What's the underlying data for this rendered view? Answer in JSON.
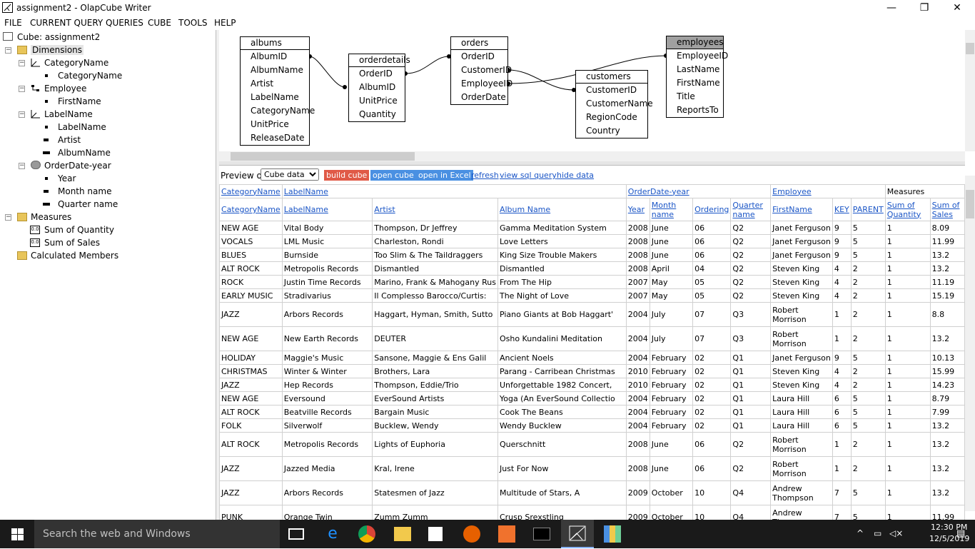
{
  "window": {
    "title": "assignment2 - OlapCube Writer",
    "minimize": "—",
    "restore": "❐",
    "close": "✕"
  },
  "menu": [
    "FILE",
    "CURRENT QUERY",
    "QUERIES",
    "CUBE",
    "TOOLS",
    "HELP"
  ],
  "tree": {
    "root": "Cube: assignment2",
    "dimensions": "Dimensions",
    "category_dim": "CategoryName",
    "category_level": "CategoryName",
    "employee_dim": "Employee",
    "employee_level": "FirstName",
    "label_dim": "LabelName",
    "label_levels": [
      "LabelName",
      "Artist",
      "AlbumName"
    ],
    "orderdate_dim": "OrderDate-year",
    "orderdate_levels": [
      "Year",
      "Month name",
      "Quarter name"
    ],
    "measures": "Measures",
    "measure_items": [
      "Sum of Quantity",
      "Sum of Sales"
    ],
    "calculated": "Calculated Members"
  },
  "diagram": {
    "albums": {
      "name": "albums",
      "fields": [
        "AlbumID",
        "AlbumName",
        "Artist",
        "LabelName",
        "CategoryName",
        "UnitPrice",
        "ReleaseDate"
      ]
    },
    "orderdetails": {
      "name": "orderdetails",
      "fields": [
        "OrderID",
        "AlbumID",
        "UnitPrice",
        "Quantity"
      ]
    },
    "orders": {
      "name": "orders",
      "fields": [
        "OrderID",
        "CustomerID",
        "EmployeeID",
        "OrderDate"
      ]
    },
    "customers": {
      "name": "customers",
      "fields": [
        "CustomerID",
        "CustomerName",
        "RegionCode",
        "Country"
      ]
    },
    "employees": {
      "name": "employees",
      "fields": [
        "EmployeeID",
        "LastName",
        "FirstName",
        "Title",
        "ReportsTo"
      ]
    }
  },
  "preview": {
    "label": "Preview of",
    "select_value": "Cube data",
    "build": "build cube",
    "open_cube": "open cube",
    "open_excel": "open in Excel",
    "links": [
      "refresh",
      "view sql query",
      "hide data"
    ],
    "colors": {
      "build": "#e05a47",
      "open": "#4a90e2"
    }
  },
  "grid": {
    "group_headers": [
      "CategoryName",
      "LabelName",
      "OrderDate-year",
      "Employee",
      "Measures"
    ],
    "columns": [
      "CategoryName",
      "LabelName",
      "Artist",
      "Album Name",
      "Year",
      "Month name",
      "Ordering",
      "Quarter name",
      "FirstName",
      "KEY",
      "PARENT",
      "Sum of Quantity",
      "Sum of Sales"
    ],
    "rows": [
      [
        "NEW AGE",
        "Vital Body",
        "Thompson, Dr Jeffrey",
        "Gamma Meditation System",
        "2008",
        "June",
        "06",
        "Q2",
        "Janet Ferguson",
        "9",
        "5",
        "1",
        "8.09"
      ],
      [
        "VOCALS",
        "LML Music",
        "Charleston, Rondi",
        "Love Letters",
        "2008",
        "June",
        "06",
        "Q2",
        "Janet Ferguson",
        "9",
        "5",
        "1",
        "11.99"
      ],
      [
        "BLUES",
        "Burnside",
        "Too Slim & The Taildraggers",
        "King Size Trouble Makers",
        "2008",
        "June",
        "06",
        "Q2",
        "Janet Ferguson",
        "9",
        "5",
        "1",
        "13.2"
      ],
      [
        "ALT ROCK",
        "Metropolis Records",
        "Dismantled",
        "Dismantled",
        "2008",
        "April",
        "04",
        "Q2",
        "Steven King",
        "4",
        "2",
        "1",
        "13.2"
      ],
      [
        "ROCK",
        "Justin Time Records",
        "Marino, Frank & Mahogany Rus",
        "From The Hip",
        "2007",
        "May",
        "05",
        "Q2",
        "Steven King",
        "4",
        "2",
        "1",
        "11.19"
      ],
      [
        "EARLY MUSIC",
        "Stradivarius",
        "Il Complesso Barocco/Curtis:",
        "The Night of Love",
        "2007",
        "May",
        "05",
        "Q2",
        "Steven King",
        "4",
        "2",
        "1",
        "15.19"
      ],
      [
        "JAZZ",
        "Arbors Records",
        "Haggart, Hyman, Smith, Sutto",
        "Piano Giants at Bob Haggart'",
        "2004",
        "July",
        "07",
        "Q3",
        "Robert Morrison",
        "1",
        "2",
        "1",
        "8.8"
      ],
      [
        "NEW AGE",
        "New Earth Records",
        "DEUTER",
        "Osho Kundalini Meditation",
        "2004",
        "July",
        "07",
        "Q3",
        "Robert Morrison",
        "1",
        "2",
        "1",
        "13.2"
      ],
      [
        "HOLIDAY",
        "Maggie's Music",
        "Sansone, Maggie & Ens Galil",
        "Ancient Noels",
        "2004",
        "February",
        "02",
        "Q1",
        "Janet Ferguson",
        "9",
        "5",
        "1",
        "10.13"
      ],
      [
        "CHRISTMAS",
        "Winter & Winter",
        "Brothers, Lara",
        "Parang - Carribean Christmas",
        "2010",
        "February",
        "02",
        "Q1",
        "Steven King",
        "4",
        "2",
        "1",
        "15.99"
      ],
      [
        "JAZZ",
        "Hep Records",
        "Thompson, Eddie/Trio",
        "Unforgettable 1982 Concert,",
        "2010",
        "February",
        "02",
        "Q1",
        "Steven King",
        "4",
        "2",
        "1",
        "14.23"
      ],
      [
        "NEW AGE",
        "Eversound",
        "EverSound Artists",
        "Yoga (An EverSound Collectio",
        "2004",
        "February",
        "02",
        "Q1",
        "Laura Hill",
        "6",
        "5",
        "1",
        "8.79"
      ],
      [
        "ALT ROCK",
        "Beatville Records",
        "Bargain Music",
        "Cook The Beans",
        "2004",
        "February",
        "02",
        "Q1",
        "Laura Hill",
        "6",
        "5",
        "1",
        "7.99"
      ],
      [
        "FOLK",
        "Silverwolf",
        "Bucklew, Wendy",
        "Wendy Bucklew",
        "2004",
        "February",
        "02",
        "Q1",
        "Laura Hill",
        "6",
        "5",
        "1",
        "13.2"
      ],
      [
        "ALT ROCK",
        "Metropolis Records",
        "Lights of Euphoria",
        "Querschnitt",
        "2008",
        "June",
        "06",
        "Q2",
        "Robert Morrison",
        "1",
        "2",
        "1",
        "13.2"
      ],
      [
        "JAZZ",
        "Jazzed Media",
        "Kral, Irene",
        "Just For Now",
        "2008",
        "June",
        "06",
        "Q2",
        "Robert Morrison",
        "1",
        "2",
        "1",
        "13.2"
      ],
      [
        "JAZZ",
        "Arbors Records",
        "Statesmen of Jazz",
        "Multitude of Stars, A",
        "2009",
        "October",
        "10",
        "Q4",
        "Andrew Thompson",
        "7",
        "5",
        "1",
        "13.2"
      ],
      [
        "PUNK",
        "Orange Twin",
        "Zumm Zumm",
        "Crusp Srexstling",
        "2009",
        "October",
        "10",
        "Q4",
        "Andrew Thompson",
        "7",
        "5",
        "1",
        "11.99"
      ]
    ]
  },
  "taskbar": {
    "search": "Search the web and Windows",
    "time": "12:30 PM",
    "date": "12/5/2019"
  }
}
